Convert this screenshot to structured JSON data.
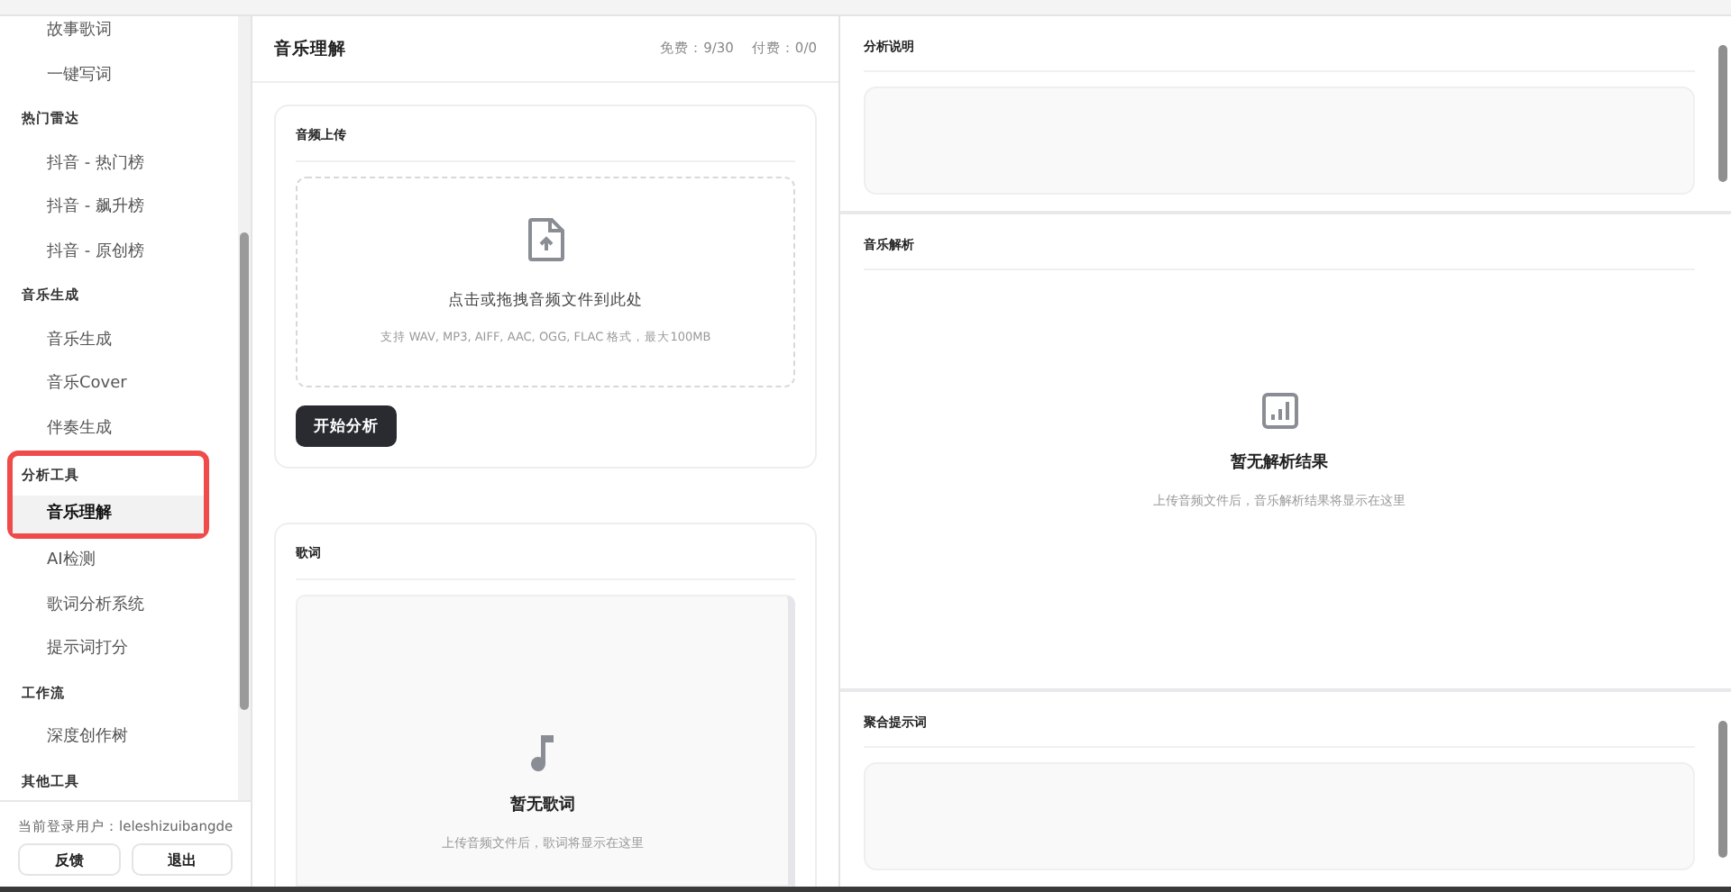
{
  "sidebar": {
    "groups": [
      {
        "items": [
          {
            "label": "故事歌词",
            "selected": false
          },
          {
            "label": "一键写词",
            "selected": false
          }
        ]
      },
      {
        "title": "热门雷达",
        "outlined": false,
        "items": [
          {
            "label": "抖音 - 热门榜",
            "selected": false
          },
          {
            "label": "抖音 - 飙升榜",
            "selected": false
          },
          {
            "label": "抖音 - 原创榜",
            "selected": false
          }
        ]
      },
      {
        "title": "音乐生成",
        "outlined": false,
        "items": [
          {
            "label": "音乐生成",
            "selected": false
          },
          {
            "label": "音乐Cover",
            "selected": false
          },
          {
            "label": "伴奏生成",
            "selected": false
          }
        ]
      },
      {
        "title": "分析工具",
        "outlined": true,
        "items": [
          {
            "label": "音乐理解",
            "selected": true
          },
          {
            "label": "AI检测",
            "selected": false
          },
          {
            "label": "歌词分析系统",
            "selected": false
          },
          {
            "label": "提示词打分",
            "selected": false
          }
        ]
      },
      {
        "title": "工作流",
        "outlined": false,
        "items": [
          {
            "label": "深度创作树",
            "selected": false
          }
        ]
      },
      {
        "title": "其他工具",
        "outlined": false
      }
    ],
    "user_label": "当前登录用户：leleshizuibangde",
    "buttons": [
      "反馈",
      "退出"
    ]
  },
  "main": {
    "title": "音乐理解",
    "quota": [
      "免费：9/30",
      "付费：0/0"
    ],
    "upload": {
      "title": "音频上传",
      "prompt": "点击或拖拽音频文件到此处",
      "hint": "支持 WAV, MP3, AIFF, AAC, OGG, FLAC 格式，最大100MB",
      "button": "开始分析"
    },
    "lyrics": {
      "title": "歌词",
      "empty_title": "暂无歌词",
      "empty_hint": "上传音频文件后，歌词将显示在这里"
    }
  },
  "right": {
    "sections": [
      {
        "kind": "textbox",
        "title": "分析说明"
      },
      {
        "kind": "empty",
        "title": "音乐解析",
        "empty_title": "暂无解析结果",
        "empty_hint": "上传音频文件后，音乐解析结果将显示在这里"
      },
      {
        "kind": "textbox",
        "title": "聚合提示词"
      }
    ]
  }
}
